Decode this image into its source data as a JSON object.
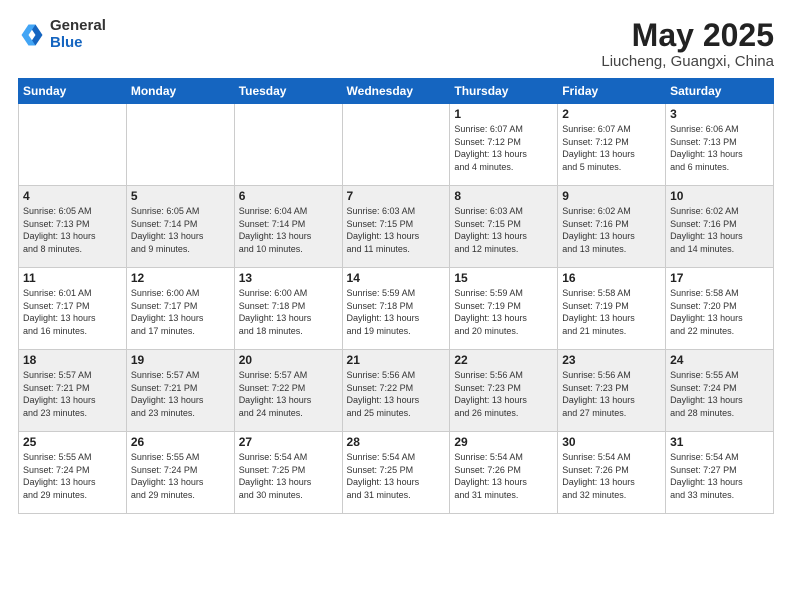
{
  "header": {
    "logo": {
      "general": "General",
      "blue": "Blue"
    },
    "title": "May 2025",
    "location": "Liucheng, Guangxi, China"
  },
  "weekdays": [
    "Sunday",
    "Monday",
    "Tuesday",
    "Wednesday",
    "Thursday",
    "Friday",
    "Saturday"
  ],
  "weeks": [
    [
      {
        "day": "",
        "info": ""
      },
      {
        "day": "",
        "info": ""
      },
      {
        "day": "",
        "info": ""
      },
      {
        "day": "",
        "info": ""
      },
      {
        "day": "1",
        "info": "Sunrise: 6:07 AM\nSunset: 7:12 PM\nDaylight: 13 hours\nand 4 minutes."
      },
      {
        "day": "2",
        "info": "Sunrise: 6:07 AM\nSunset: 7:12 PM\nDaylight: 13 hours\nand 5 minutes."
      },
      {
        "day": "3",
        "info": "Sunrise: 6:06 AM\nSunset: 7:13 PM\nDaylight: 13 hours\nand 6 minutes."
      }
    ],
    [
      {
        "day": "4",
        "info": "Sunrise: 6:05 AM\nSunset: 7:13 PM\nDaylight: 13 hours\nand 8 minutes."
      },
      {
        "day": "5",
        "info": "Sunrise: 6:05 AM\nSunset: 7:14 PM\nDaylight: 13 hours\nand 9 minutes."
      },
      {
        "day": "6",
        "info": "Sunrise: 6:04 AM\nSunset: 7:14 PM\nDaylight: 13 hours\nand 10 minutes."
      },
      {
        "day": "7",
        "info": "Sunrise: 6:03 AM\nSunset: 7:15 PM\nDaylight: 13 hours\nand 11 minutes."
      },
      {
        "day": "8",
        "info": "Sunrise: 6:03 AM\nSunset: 7:15 PM\nDaylight: 13 hours\nand 12 minutes."
      },
      {
        "day": "9",
        "info": "Sunrise: 6:02 AM\nSunset: 7:16 PM\nDaylight: 13 hours\nand 13 minutes."
      },
      {
        "day": "10",
        "info": "Sunrise: 6:02 AM\nSunset: 7:16 PM\nDaylight: 13 hours\nand 14 minutes."
      }
    ],
    [
      {
        "day": "11",
        "info": "Sunrise: 6:01 AM\nSunset: 7:17 PM\nDaylight: 13 hours\nand 16 minutes."
      },
      {
        "day": "12",
        "info": "Sunrise: 6:00 AM\nSunset: 7:17 PM\nDaylight: 13 hours\nand 17 minutes."
      },
      {
        "day": "13",
        "info": "Sunrise: 6:00 AM\nSunset: 7:18 PM\nDaylight: 13 hours\nand 18 minutes."
      },
      {
        "day": "14",
        "info": "Sunrise: 5:59 AM\nSunset: 7:18 PM\nDaylight: 13 hours\nand 19 minutes."
      },
      {
        "day": "15",
        "info": "Sunrise: 5:59 AM\nSunset: 7:19 PM\nDaylight: 13 hours\nand 20 minutes."
      },
      {
        "day": "16",
        "info": "Sunrise: 5:58 AM\nSunset: 7:19 PM\nDaylight: 13 hours\nand 21 minutes."
      },
      {
        "day": "17",
        "info": "Sunrise: 5:58 AM\nSunset: 7:20 PM\nDaylight: 13 hours\nand 22 minutes."
      }
    ],
    [
      {
        "day": "18",
        "info": "Sunrise: 5:57 AM\nSunset: 7:21 PM\nDaylight: 13 hours\nand 23 minutes."
      },
      {
        "day": "19",
        "info": "Sunrise: 5:57 AM\nSunset: 7:21 PM\nDaylight: 13 hours\nand 23 minutes."
      },
      {
        "day": "20",
        "info": "Sunrise: 5:57 AM\nSunset: 7:22 PM\nDaylight: 13 hours\nand 24 minutes."
      },
      {
        "day": "21",
        "info": "Sunrise: 5:56 AM\nSunset: 7:22 PM\nDaylight: 13 hours\nand 25 minutes."
      },
      {
        "day": "22",
        "info": "Sunrise: 5:56 AM\nSunset: 7:23 PM\nDaylight: 13 hours\nand 26 minutes."
      },
      {
        "day": "23",
        "info": "Sunrise: 5:56 AM\nSunset: 7:23 PM\nDaylight: 13 hours\nand 27 minutes."
      },
      {
        "day": "24",
        "info": "Sunrise: 5:55 AM\nSunset: 7:24 PM\nDaylight: 13 hours\nand 28 minutes."
      }
    ],
    [
      {
        "day": "25",
        "info": "Sunrise: 5:55 AM\nSunset: 7:24 PM\nDaylight: 13 hours\nand 29 minutes."
      },
      {
        "day": "26",
        "info": "Sunrise: 5:55 AM\nSunset: 7:24 PM\nDaylight: 13 hours\nand 29 minutes."
      },
      {
        "day": "27",
        "info": "Sunrise: 5:54 AM\nSunset: 7:25 PM\nDaylight: 13 hours\nand 30 minutes."
      },
      {
        "day": "28",
        "info": "Sunrise: 5:54 AM\nSunset: 7:25 PM\nDaylight: 13 hours\nand 31 minutes."
      },
      {
        "day": "29",
        "info": "Sunrise: 5:54 AM\nSunset: 7:26 PM\nDaylight: 13 hours\nand 31 minutes."
      },
      {
        "day": "30",
        "info": "Sunrise: 5:54 AM\nSunset: 7:26 PM\nDaylight: 13 hours\nand 32 minutes."
      },
      {
        "day": "31",
        "info": "Sunrise: 5:54 AM\nSunset: 7:27 PM\nDaylight: 13 hours\nand 33 minutes."
      }
    ]
  ]
}
